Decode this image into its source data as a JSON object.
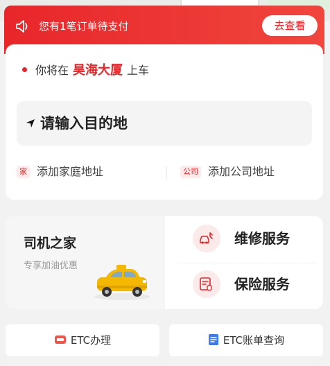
{
  "banner": {
    "message": "您有1笔订单待支付",
    "button_label": "去查看"
  },
  "pickup": {
    "prefix": "你将在",
    "place": "昊海大厦",
    "suffix": "上车"
  },
  "destination": {
    "placeholder": "请输入目的地"
  },
  "shortcuts": {
    "home_tag": "家",
    "home_label": "添加家庭地址",
    "work_tag": "公司",
    "work_label": "添加公司地址"
  },
  "driver_home": {
    "title": "司机之家",
    "subtitle": "专享加油优惠"
  },
  "services": [
    {
      "label": "维修服务",
      "icon": "wrench-car-icon"
    },
    {
      "label": "保险服务",
      "icon": "insurance-doc-icon"
    }
  ],
  "etc": {
    "apply_label": "ETC办理",
    "bill_label": "ETC账单查询"
  },
  "colors": {
    "accent": "#e8262a",
    "taxi": "#f5b800"
  }
}
